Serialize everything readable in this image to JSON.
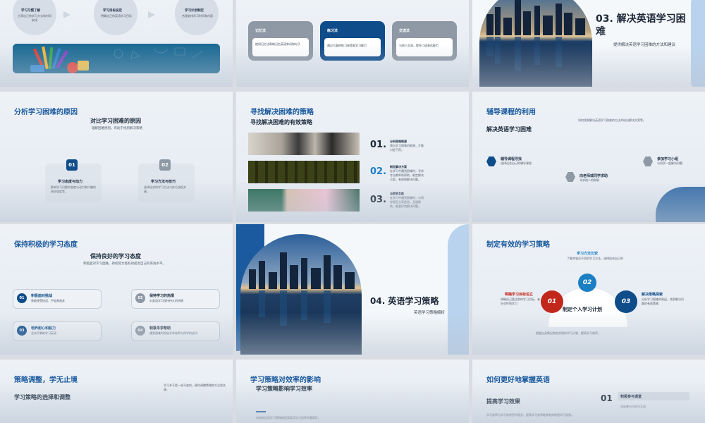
{
  "s1": {
    "circles": [
      {
        "title": "学习习惯了解",
        "desc": "分享自己的学习方式和时间安排"
      },
      {
        "title": "学习目标设定",
        "desc": "明确自己的英语学习目标"
      },
      {
        "title": "学习计划制定",
        "desc": "合理安排学习时间和内容"
      }
    ]
  },
  "s2": {
    "cards": [
      {
        "title": "记忆法",
        "desc": "使用记忆法帮助记忆英语单词和句子"
      },
      {
        "title": "练习法",
        "desc": "通过大量的练习来提高学习能力"
      },
      {
        "title": "交流法",
        "desc": "与他人交流，提升口语表达能力"
      }
    ]
  },
  "s3": {
    "title": "03. 解决英语学习困难",
    "subtitle": "提供解决英语学习困难的方法和建议"
  },
  "s4": {
    "title": "分析学习困难的原因",
    "heading": "对比学习困难的原因",
    "heading_desc": "理解困难原因，有助于找到解决策略",
    "items": [
      {
        "num": "01",
        "title": "学习态度与动力",
        "desc": "影响学习问题的态度与动力和兴趣的高低强度等。"
      },
      {
        "num": "02",
        "title": "学习方法与技巧",
        "desc": "选择适合的学习方法与技巧也很关键。"
      }
    ]
  },
  "s5": {
    "title": "寻找解决困难的策略",
    "heading": "寻找解决困难的有效策略",
    "items": [
      {
        "num": "01.",
        "title": "分析困难根源",
        "desc": "找出学习困难的根源，才能对症下药。"
      },
      {
        "num": "02.",
        "title": "制定解决方案",
        "desc": "在学习中遇到困难时，寻求专业教师的帮助，制定解决方案，有效地解决问题。"
      },
      {
        "num": "03.",
        "title": "与同学互助",
        "desc": "在学习中遇到困难时，与同学相互分享经验，互相帮助，能更好地解决问题。"
      }
    ]
  },
  "s6": {
    "title": "辅导课程的利用",
    "heading": "解决英语学习困难",
    "top_note": "如何找到解决英语学习困难的方法并给出解决方案等。",
    "items": [
      {
        "title": "辅导课程寻找",
        "desc": "选择适合自己的辅导课程"
      },
      {
        "title": "参加学习小组",
        "desc": "与同学一起解决问题"
      },
      {
        "title": "向老师或同学求助",
        "desc": "寻求他人的帮助"
      }
    ]
  },
  "s7": {
    "title": "保持积极的学习态度",
    "heading": "保持良好的学习态度",
    "heading_desc": "积极面对学习困难，持续努力能有效提高自己的英语水平。",
    "items": [
      {
        "num": "01",
        "title": "积极面对挑战",
        "desc": "勇敢接受挑战，不轻易放弃"
      },
      {
        "num": "02",
        "title": "保持学习的热情",
        "desc": "对英语学习保持持久的热情"
      },
      {
        "num": "03",
        "title": "培养耐心和毅力",
        "desc": "坚持不懈地学习英语"
      },
      {
        "num": "04",
        "title": "积极寻求帮助",
        "desc": "遇到困难时积极寻求老师与同学的支持"
      }
    ]
  },
  "s8": {
    "title": "04. 英语学习策略",
    "subtitle": "英语学习策略解析"
  },
  "s9": {
    "title": "制定有效的学习策略",
    "center": "制定个人学习计划",
    "bottom_note": "根据自身情况制定合理的学习计划，提高学习效率。",
    "nodes": [
      {
        "num": "01",
        "title": "明确学习目标设立",
        "desc": "明确自己要达到的学习目标，有针对性地学习"
      },
      {
        "num": "02",
        "title": "学习方法比较",
        "desc": "了解并尝试不同的学习方法，选择适合自己的"
      },
      {
        "num": "03",
        "title": "解决策略探索",
        "desc": "分析学习困难的原因，找到解决问题的有效策略"
      }
    ]
  },
  "s10": {
    "title": "策略调整，学无止境",
    "heading": "学习策略的选择和调整",
    "right_note": "学习并不是一成不变的，随时调整策略和方法是关键。"
  },
  "s11": {
    "title": "学习策略对效率的影响",
    "heading": "学习策略影响学习效率",
    "bottom_note": "有效地运用学习策略能提高英语学习效率的重要性。"
  },
  "s12": {
    "title": "如何更好地掌握英语",
    "heading": "提高学习效果",
    "num": "01",
    "item_title": "积极参与课堂",
    "item_desc": "主动参与讨论与互动",
    "bottom_note": "学习效率与学习效果密切相关，提高学习效率能够有效增强学习效果。"
  },
  "colors": {
    "brand_blue": "#1b5a9e",
    "dark_blue": "#0f4c8a",
    "card_gray": "#8b96a2",
    "red": "#c1281b"
  }
}
